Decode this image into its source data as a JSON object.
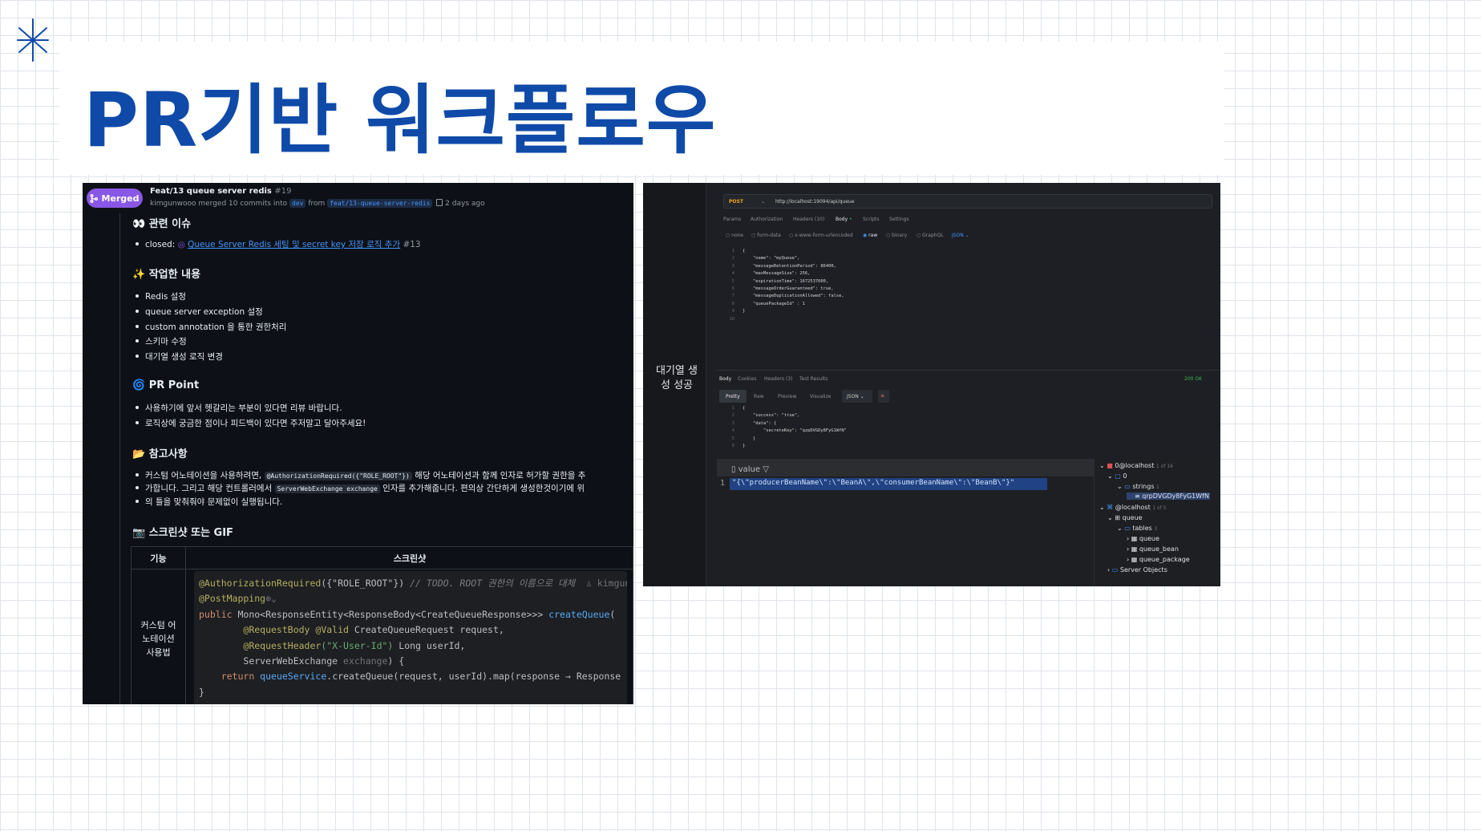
{
  "slide": {
    "title": "PR기반 워크플로우",
    "accent": "#0f4aa8",
    "star_icon": "asterisk-star-icon"
  },
  "github": {
    "badge": "Merged",
    "pr_title": "Feat/13 queue server redis",
    "pr_number": "#19",
    "author": "kimgunwooo",
    "merge_text": "merged 10 commits into",
    "base_branch": "dev",
    "from_text": "from",
    "head_branch": "feat/13-queue-server-redis",
    "time": "2 days ago",
    "sections": {
      "related": "관련 이슈",
      "closed_label": "closed:",
      "closed_link": "Queue Server Redis 세팅 및 secret key 저장 로직 추가",
      "closed_num": "#13",
      "work": "작업한 내용",
      "work_items": [
        "Redis 설정",
        "queue server exception 설정",
        "custom annotation 을 통한 권한처리",
        "스키마 수정",
        "대기열 생성 로직 변경"
      ],
      "pr_point": "PR Point",
      "pr_items": [
        "사용하기에 앞서 헷갈리는 부분이 있다면 리뷰 바랍니다.",
        "로직상에 궁금한 점이나 피드백이 있다면 주저말고 달아주세요!"
      ],
      "notes": "참고사항",
      "notes_line1_a": "커스텀 어노테이션을 사용하려면,",
      "notes_code1": "@AuthorizationRequired({\"ROLE_ROOT\"})",
      "notes_line1_b": "해당 어노테이션과 함께 인자로 허가할 권한을 추",
      "notes_line2_a": "가합니다. 그리고 해당 컨트롤러에서",
      "notes_code2": "ServerWebExchange exchange",
      "notes_line2_b": "인자를 추가해줍니다. 편의상 간단하게 생성한것이기에 위",
      "notes_line3": "의 틀을 맞춰줘야 문제없이 실행됩니다.",
      "screens": "스크린샷 또는 GIF"
    },
    "table": {
      "col1": "기능",
      "col2": "스크린샷",
      "row_label": "커스텀 어노테이션 사용법"
    },
    "code": {
      "l1_ann": "@AuthorizationRequired",
      "l1_args": "({\"ROLE_ROOT\"})",
      "l1_comment": " // TODO. ROOT 권한의 이름으로 대체",
      "l1_author": "  ♙ kimgunw",
      "l2": "@PostMapping",
      "l3_kw": "public ",
      "l3_type": "Mono<ResponseEntity<ResponseBody<CreateQueueResponse>>> ",
      "l3_fn": "createQueue",
      "l3_end": "(",
      "l4_ann": "@RequestBody @Valid ",
      "l4_rest": "CreateQueueRequest request,",
      "l5_ann": "@RequestHeader",
      "l5_str": "(\"X-User-Id\")",
      "l5_rest": " Long userId,",
      "l6_a": "ServerWebExchange ",
      "l6_b": "exchange",
      "l6_c": ") {",
      "l7_kw": "return ",
      "l7_svc": "queueService",
      "l7_rest": ".createQueue(request, userId).map(response → Response",
      "l8": "}"
    }
  },
  "postman": {
    "caption": "대기열 생성 성공",
    "method": "POST",
    "url": "http://localhost:19094/api/queue",
    "req_tabs": [
      "Params",
      "Authorization",
      "Headers (10)",
      "Body",
      "Scripts",
      "Settings"
    ],
    "body_types": [
      "none",
      "form-data",
      "x-www-form-urlencoded",
      "raw",
      "binary",
      "GraphQL",
      "JSON"
    ],
    "req_lines": [
      "{",
      "    \"name\": \"myQueue\",",
      "    \"messageRetentionPeriod\": 86400,",
      "    \"maxMessageSize\": 256,",
      "    \"expirationTime\": 1672537600,",
      "    \"messageOrderGuaranteed\": true,",
      "    \"messageDuplicationAllowed\": false,",
      "    \"queuePackageId\" : 1",
      "}",
      ""
    ],
    "resp_tabs": [
      "Body",
      "Cookies",
      "Headers (3)",
      "Test Results"
    ],
    "status": "200 OK",
    "view_tabs": [
      "Pretty",
      "Raw",
      "Preview",
      "Visualize",
      "JSON"
    ],
    "resp_lines": [
      "{",
      "    \"success\": \"true\",",
      "    \"data\": {",
      "        \"secreteKey\": \"qzpDVGDy8FyG1WfN\"",
      "    }",
      "}"
    ]
  },
  "redis": {
    "column": "value",
    "row_num": "1",
    "value": "\"{\\\"producerBeanName\\\":\\\"BeanA\\\",\\\"consumerBeanName\\\":\\\"BeanB\\\"}\"",
    "tree": {
      "conn1": "0@localhost",
      "conn1_count": "1 of 16",
      "db0": "0",
      "strings": "strings",
      "strings_count": "1",
      "key": "qrpDVGDy8FyG1WfN",
      "conn2": "@localhost",
      "conn2_count": "1 of 5",
      "schema": "queue",
      "tables": "tables",
      "tables_count": "3",
      "t1": "queue",
      "t2": "queue_bean",
      "t3": "queue_package",
      "server_objects": "Server Objects"
    }
  }
}
